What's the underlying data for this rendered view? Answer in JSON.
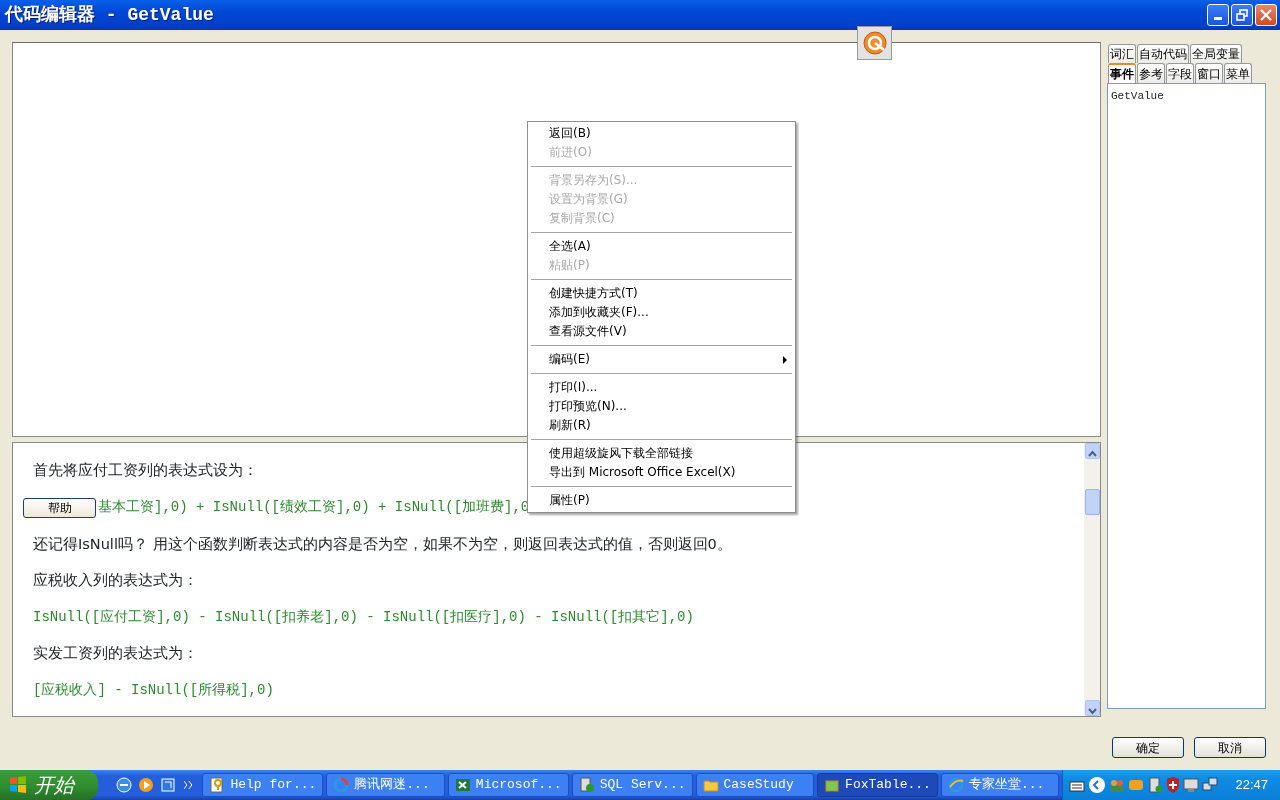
{
  "window": {
    "title": "代码编辑器 - GetValue"
  },
  "help_pane": {
    "button": "帮助",
    "paragraphs": [
      {
        "kind": "text",
        "text": "首先将应付工资列的表达式设为："
      },
      {
        "kind": "code",
        "text": "基本工资],0) + IsNull([绩效工资],0) + IsNull([加班费],0",
        "has_button": true
      },
      {
        "kind": "text",
        "text": "还记得IsNull吗？ 用这个函数判断表达式的内容是否为空，如果不为空，则返回表达式的值，否则返回0。"
      },
      {
        "kind": "text",
        "text": "应税收入列的表达式为："
      },
      {
        "kind": "code",
        "text": "IsNull([应付工资],0) - IsNull([扣养老],0) - IsNull([扣医疗],0) - IsNull([扣其它],0)"
      },
      {
        "kind": "text",
        "text": "实发工资列的表达式为："
      },
      {
        "kind": "code",
        "text": "[应税收入] - IsNull([所得税],0)"
      }
    ]
  },
  "context_menu": [
    {
      "kind": "item",
      "text": "返回(B)",
      "disabled": false
    },
    {
      "kind": "item",
      "text": "前进(O)",
      "disabled": true
    },
    {
      "kind": "separator"
    },
    {
      "kind": "item",
      "text": "背景另存为(S)...",
      "disabled": true
    },
    {
      "kind": "item",
      "text": "设置为背景(G)",
      "disabled": true
    },
    {
      "kind": "item",
      "text": "复制背景(C)",
      "disabled": true
    },
    {
      "kind": "separator"
    },
    {
      "kind": "item",
      "text": "全选(A)",
      "disabled": false
    },
    {
      "kind": "item",
      "text": "粘贴(P)",
      "disabled": true
    },
    {
      "kind": "separator"
    },
    {
      "kind": "item",
      "text": "创建快捷方式(T)",
      "disabled": false
    },
    {
      "kind": "item",
      "text": "添加到收藏夹(F)...",
      "disabled": false
    },
    {
      "kind": "item",
      "text": "查看源文件(V)",
      "disabled": false
    },
    {
      "kind": "separator"
    },
    {
      "kind": "item",
      "text": "编码(E)",
      "disabled": false,
      "submenu": true
    },
    {
      "kind": "separator"
    },
    {
      "kind": "item",
      "text": "打印(I)...",
      "disabled": false
    },
    {
      "kind": "item",
      "text": "打印预览(N)...",
      "disabled": false
    },
    {
      "kind": "item",
      "text": "刷新(R)",
      "disabled": false
    },
    {
      "kind": "separator"
    },
    {
      "kind": "item",
      "text": "使用超级旋风下载全部链接",
      "disabled": false
    },
    {
      "kind": "item",
      "text": "导出到 Microsoft Office Excel(X)",
      "disabled": false
    },
    {
      "kind": "separator"
    },
    {
      "kind": "item",
      "text": "属性(P)",
      "disabled": false
    }
  ],
  "side_panel": {
    "tab_rows": [
      [
        {
          "label": "词汇",
          "selected": false
        },
        {
          "label": "自动代码",
          "selected": false
        },
        {
          "label": "全局变量",
          "selected": false
        }
      ],
      [
        {
          "label": "事件",
          "selected": true
        },
        {
          "label": "参考",
          "selected": false
        },
        {
          "label": "字段",
          "selected": false
        },
        {
          "label": "窗口",
          "selected": false
        },
        {
          "label": "菜单",
          "selected": false
        }
      ]
    ],
    "items": [
      "GetValue"
    ]
  },
  "buttons": [
    "确定",
    "取消"
  ],
  "taskbar": {
    "start": "开始",
    "tasks": [
      {
        "label": "Help for...",
        "selected": false
      },
      {
        "label": "腾讯网迷...",
        "selected": false
      },
      {
        "label": "Microsof...",
        "selected": false
      },
      {
        "label": "SQL Serv...",
        "selected": false
      },
      {
        "label": "CaseStudy",
        "selected": false
      },
      {
        "label": "FoxTable...",
        "selected": true
      },
      {
        "label": "专家坐堂...",
        "selected": false
      }
    ],
    "clock": "22:47"
  }
}
